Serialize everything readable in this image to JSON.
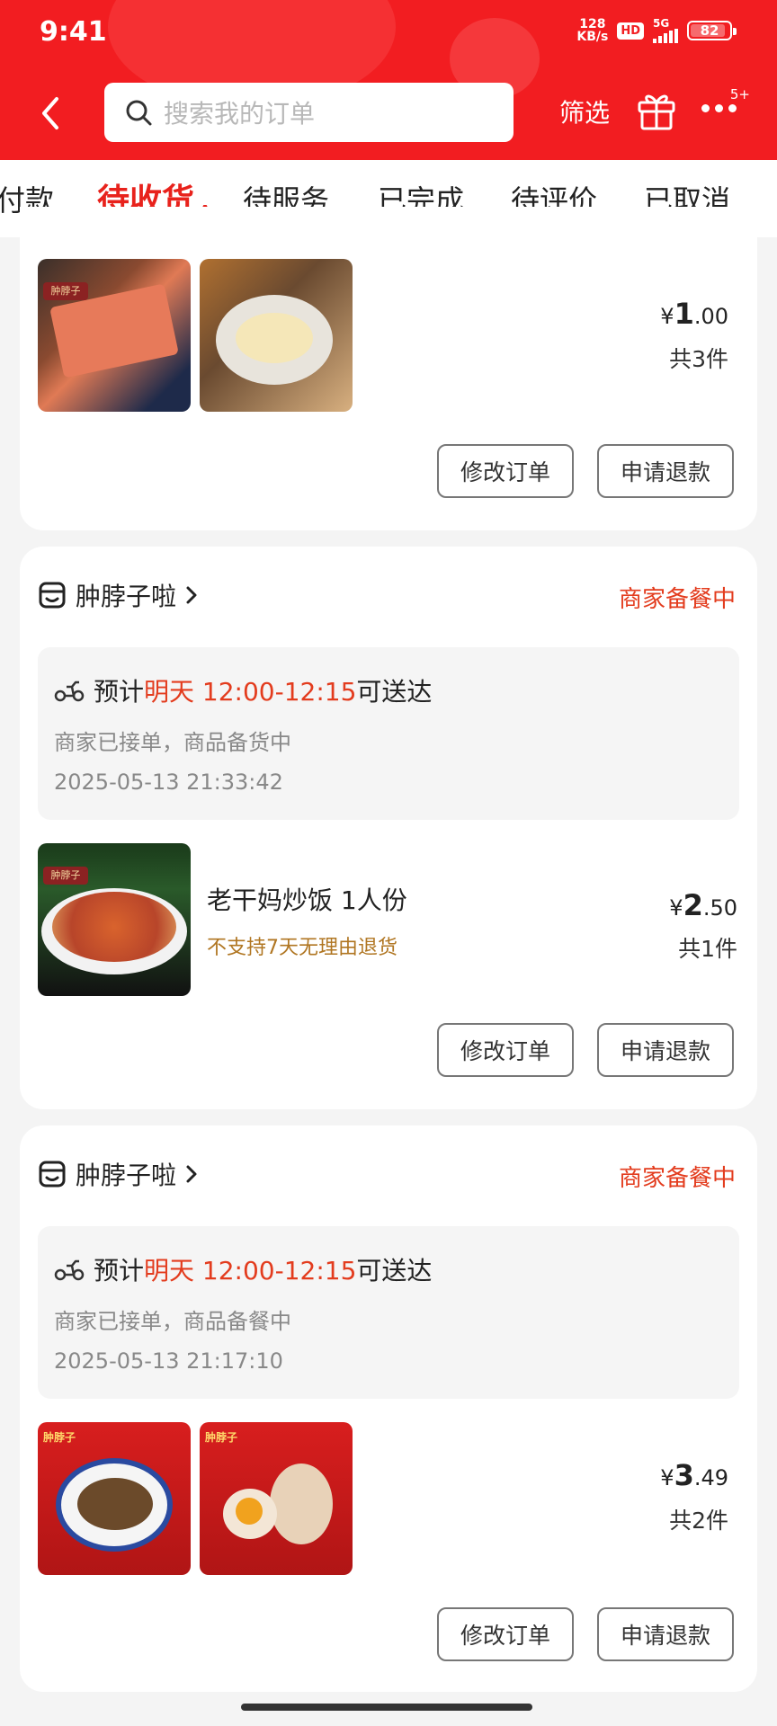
{
  "status_bar": {
    "time": "9:41",
    "net_speed_value": "128",
    "net_speed_unit": "KB/s",
    "hd": "HD",
    "network": "5G",
    "battery": "82"
  },
  "header": {
    "search_placeholder": "搜索我的订单",
    "filter_label": "筛选",
    "more_badge": "5+"
  },
  "tabs": [
    "付款",
    "待收货",
    "待服务",
    "已完成",
    "待评价",
    "已取消"
  ],
  "active_tab": "待收货",
  "orders": [
    {
      "price_symbol": "¥",
      "price_int": "1",
      "price_dec": ".00",
      "count": "共3件",
      "images": [
        "fried-luncheon-meat",
        "fried-egg"
      ],
      "buttons": [
        "修改订单",
        "申请退款"
      ]
    },
    {
      "shop": "肿脖子啦",
      "status": "商家备餐中",
      "delivery_prefix": "预计",
      "delivery_highlight": "明天 12:00-12:15",
      "delivery_suffix": "可送达",
      "delivery_sub": "商家已接单，商品备货中",
      "delivery_time": "2025-05-13 21:33:42",
      "item_title": "老干妈炒饭 1人份",
      "item_note": "不支持7天无理由退货",
      "price_symbol": "¥",
      "price_int": "2",
      "price_dec": ".50",
      "count": "共1件",
      "buttons": [
        "修改订单",
        "申请退款"
      ]
    },
    {
      "shop": "肿脖子啦",
      "status": "商家备餐中",
      "delivery_prefix": "预计",
      "delivery_highlight": "明天 12:00-12:15",
      "delivery_suffix": "可送达",
      "delivery_sub": "商家已接单，商品备餐中",
      "delivery_time": "2025-05-13 21:17:10",
      "price_symbol": "¥",
      "price_int": "3",
      "price_dec": ".49",
      "count": "共2件",
      "images": [
        "stir-fried-noodles",
        "eggs"
      ],
      "buttons": [
        "修改订单",
        "申请退款"
      ]
    }
  ],
  "colors": {
    "brand_red": "#f21d21",
    "accent_red": "#e33c1e",
    "note_orange": "#b07622"
  }
}
